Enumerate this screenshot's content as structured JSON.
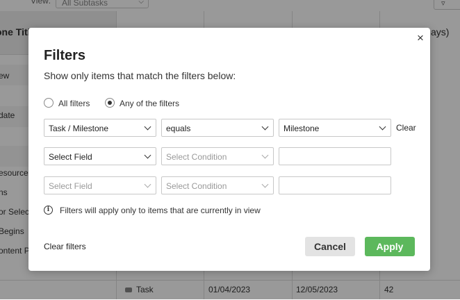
{
  "background": {
    "view_label": "View:",
    "view_select": "All Subtasks",
    "header_title": "one Title",
    "header_right": "ays)",
    "left_rows": [
      "ew",
      "date",
      "esources",
      "ns",
      "or Selec",
      "Begins",
      "ontent Pl"
    ],
    "bottom_row": {
      "type": "Task",
      "start": "01/04/2023",
      "end": "12/05/2023",
      "duration": "42"
    }
  },
  "modal": {
    "title": "Filters",
    "subtitle": "Show only items that match the filters below:",
    "radio": {
      "all_label": "All filters",
      "any_label": "Any of the filters",
      "selected": "any"
    },
    "rows": [
      {
        "field": "Task / Milestone",
        "condition": "equals",
        "value": "Milestone",
        "clear": "Clear"
      },
      {
        "field": "Select Field",
        "condition": "Select Condition",
        "value": ""
      },
      {
        "field": "Select Field",
        "condition": "Select Condition",
        "value": ""
      }
    ],
    "info_text": "Filters will apply only to items that are currently in view",
    "clear_filters": "Clear filters",
    "cancel": "Cancel",
    "apply": "Apply",
    "close_icon": "×"
  },
  "colors": {
    "apply_button": "#5cb85c",
    "cancel_button": "#e3e3e3",
    "overlay": "rgba(0,0,0,0.40)"
  }
}
